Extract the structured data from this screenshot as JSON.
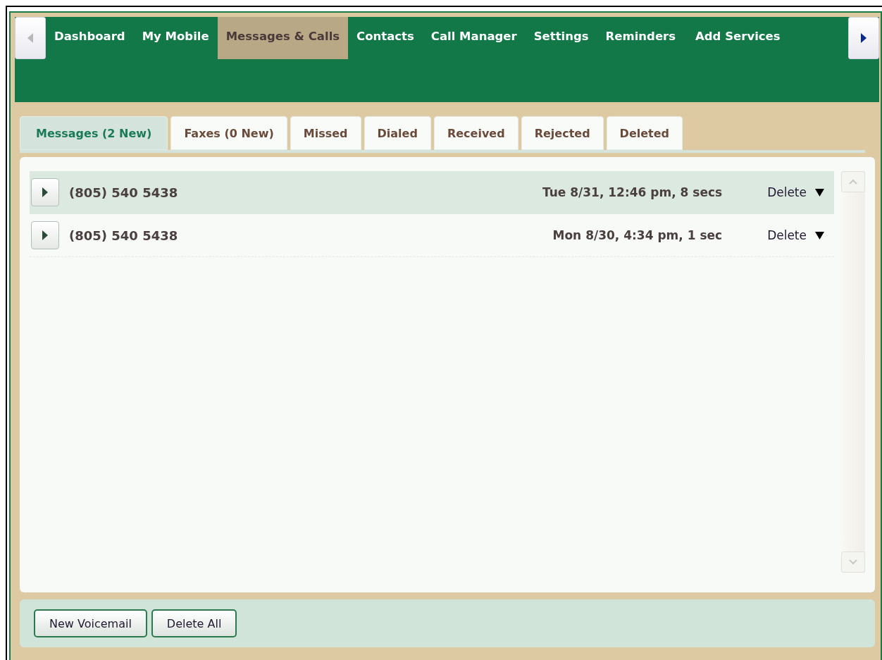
{
  "nav": {
    "items": [
      {
        "label": "Dashboard",
        "selected": false
      },
      {
        "label": "My Mobile",
        "selected": false
      },
      {
        "label": "Messages & Calls",
        "selected": true
      },
      {
        "label": "Contacts",
        "selected": false
      },
      {
        "label": "Call Manager",
        "selected": false
      },
      {
        "label": "Settings",
        "selected": false
      },
      {
        "label": "Reminders",
        "selected": false
      },
      {
        "label": "Add Services",
        "selected": false
      }
    ]
  },
  "tabs": [
    {
      "label": "Messages (2 New)",
      "selected": true
    },
    {
      "label": "Faxes (0 New)",
      "selected": false
    },
    {
      "label": "Missed",
      "selected": false
    },
    {
      "label": "Dialed",
      "selected": false
    },
    {
      "label": "Received",
      "selected": false
    },
    {
      "label": "Rejected",
      "selected": false
    },
    {
      "label": "Deleted",
      "selected": false
    }
  ],
  "messages": [
    {
      "number": "(805) 540 5438",
      "time": "Tue 8/31, 12:46 pm, 8 secs",
      "action": "Delete",
      "selected": true
    },
    {
      "number": "(805) 540 5438",
      "time": "Mon 8/30, 4:34 pm, 1 sec",
      "action": "Delete",
      "selected": false
    }
  ],
  "buttons": [
    "New Voicemail",
    "Delete All"
  ]
}
